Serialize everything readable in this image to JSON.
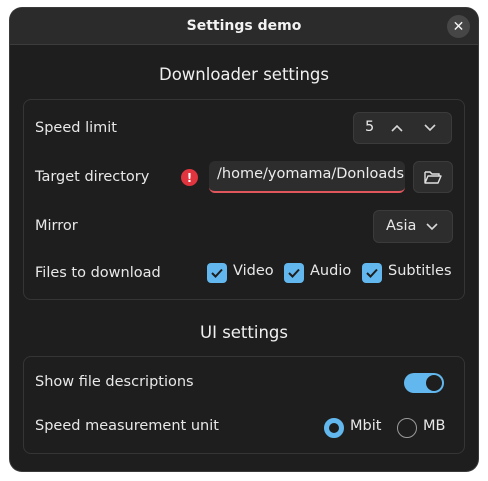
{
  "window": {
    "title": "Settings demo",
    "close_glyph": "✕"
  },
  "downloader": {
    "heading": "Downloader settings",
    "speed_limit": {
      "label": "Speed limit",
      "value": "5"
    },
    "target_directory": {
      "label": "Target directory",
      "value": "/home/yomama/Donloads",
      "error": true
    },
    "mirror": {
      "label": "Mirror",
      "selected": "Asia"
    },
    "files": {
      "label": "Files to download",
      "options": [
        {
          "label": "Video",
          "checked": true
        },
        {
          "label": "Audio",
          "checked": true
        },
        {
          "label": "Subtitles",
          "checked": true
        }
      ]
    }
  },
  "ui": {
    "heading": "UI settings",
    "show_descriptions": {
      "label": "Show file descriptions",
      "on": true
    },
    "speed_unit": {
      "label": "Speed measurement unit",
      "options": [
        {
          "label": "Mbit",
          "selected": true
        },
        {
          "label": "MB",
          "selected": false
        }
      ]
    }
  },
  "colors": {
    "accent": "#62b8ee",
    "error": "#e0343e",
    "window_bg": "#1e1e1e"
  },
  "icons": {
    "error": "!",
    "check": "✓"
  }
}
